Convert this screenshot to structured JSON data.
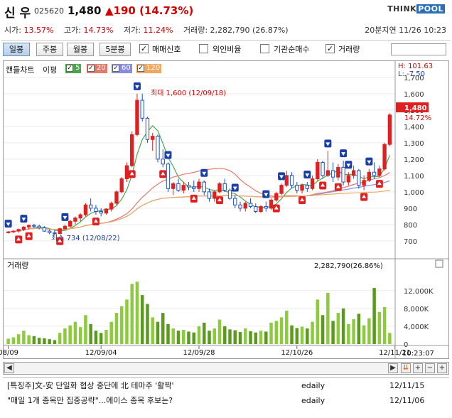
{
  "header": {
    "name": "신 우",
    "code": "025620",
    "price": "1,480",
    "change": "▲190 (14.73%)",
    "logo_think": "THINK",
    "logo_pool": "POOL"
  },
  "stats": {
    "open_label": "시가:",
    "open_value": "13.57%",
    "high_label": "고가:",
    "high_value": "14.73%",
    "low_label": "저가:",
    "low_value": "11.24%",
    "volume": "거래량: 2,282,790 (26.87%)",
    "time": "20분지연  11/26 10:23"
  },
  "toolbar": {
    "period_buttons": [
      "일봉",
      "주봉",
      "월봉",
      "5분봉"
    ],
    "options": [
      {
        "label": "매매신호",
        "checked": true
      },
      {
        "label": "외인비율",
        "checked": false
      },
      {
        "label": "기관순매수",
        "checked": false
      },
      {
        "label": "거래량",
        "checked": true
      }
    ]
  },
  "price_panel": {
    "label": "캔들차트",
    "ma_label": "이평",
    "ma": [
      {
        "period": "5",
        "color": "#4aa64a"
      },
      {
        "period": "20",
        "color": "#e07a6a"
      },
      {
        "period": "60",
        "color": "#8a8ae0"
      },
      {
        "period": "120",
        "color": "#f0a860"
      }
    ],
    "high_label": "H: 101.63",
    "low_label": "L: -7.50",
    "current_price_tag": "1,480",
    "current_change_tag": "14.72%",
    "max_annotation": "최대 1,600 (12/09/18)",
    "min_annotation": "최소 734 (12/08/22)"
  },
  "volume_panel": {
    "label": "거래량",
    "value_label": "2,282,790(26.86%)"
  },
  "bottom_time": "10:23:07",
  "news": [
    {
      "title": "[특징주]文-安 단일화 협상 중단에 北 테마주 '활짝'",
      "source": "edaily",
      "date": "12/11/15"
    },
    {
      "title": "\"매일 1개 종목만 집중공략\"...에이스 종목 후보는?",
      "source": "edaily",
      "date": "12/11/06"
    }
  ],
  "chart_data": {
    "type": "candlestick",
    "price_axis": {
      "ticks": [
        700,
        800,
        900,
        1000,
        1100,
        1200,
        1300,
        1400,
        1500,
        1600,
        1700
      ],
      "ylim": [
        630,
        1760
      ]
    },
    "volume_axis": {
      "ticks": [
        "0",
        "4,000K",
        "8,000K",
        "12,000K"
      ],
      "ylim_k": [
        0,
        15000
      ]
    },
    "x_ticks": [
      "08/09",
      "12/09/04",
      "12/09/28",
      "12/10/26",
      "12/11/21"
    ],
    "x_tick_index": [
      0,
      18,
      37,
      56,
      75
    ],
    "candles": [
      [
        750,
        760,
        745,
        755
      ],
      [
        755,
        765,
        748,
        760
      ],
      [
        760,
        775,
        750,
        770
      ],
      [
        770,
        790,
        760,
        785
      ],
      [
        785,
        800,
        770,
        795
      ],
      [
        795,
        805,
        780,
        790
      ],
      [
        790,
        800,
        770,
        780
      ],
      [
        780,
        790,
        755,
        760
      ],
      [
        760,
        770,
        740,
        750
      ],
      [
        750,
        765,
        734,
        745
      ],
      [
        745,
        780,
        740,
        775
      ],
      [
        775,
        800,
        765,
        790
      ],
      [
        790,
        830,
        780,
        820
      ],
      [
        820,
        850,
        800,
        840
      ],
      [
        840,
        870,
        820,
        860
      ],
      [
        860,
        930,
        850,
        920
      ],
      [
        920,
        960,
        880,
        900
      ],
      [
        900,
        920,
        860,
        880
      ],
      [
        880,
        900,
        850,
        870
      ],
      [
        870,
        900,
        860,
        895
      ],
      [
        895,
        940,
        880,
        930
      ],
      [
        930,
        1010,
        920,
        1000
      ],
      [
        1000,
        1090,
        990,
        1080
      ],
      [
        1080,
        1180,
        1060,
        1160
      ],
      [
        1160,
        1370,
        1150,
        1350
      ],
      [
        1350,
        1600,
        1340,
        1560
      ],
      [
        1560,
        1600,
        1430,
        1450
      ],
      [
        1450,
        1460,
        1300,
        1320
      ],
      [
        1320,
        1360,
        1250,
        1340
      ],
      [
        1340,
        1350,
        1180,
        1200
      ],
      [
        1200,
        1260,
        1150,
        1170
      ],
      [
        1170,
        1180,
        1000,
        1020
      ],
      [
        1020,
        1060,
        980,
        1050
      ],
      [
        1050,
        1080,
        1000,
        1010
      ],
      [
        1010,
        1060,
        990,
        1040
      ],
      [
        1040,
        1060,
        1010,
        1030
      ],
      [
        1030,
        1070,
        1000,
        1020
      ],
      [
        1020,
        1080,
        1000,
        1060
      ],
      [
        1060,
        1070,
        980,
        1000
      ],
      [
        1000,
        1020,
        940,
        960
      ],
      [
        960,
        1010,
        940,
        1000
      ],
      [
        1000,
        1060,
        990,
        1050
      ],
      [
        1050,
        1080,
        1000,
        1010
      ],
      [
        1010,
        1020,
        950,
        960
      ],
      [
        960,
        980,
        900,
        920
      ],
      [
        920,
        940,
        880,
        900
      ],
      [
        900,
        940,
        880,
        930
      ],
      [
        930,
        960,
        900,
        910
      ],
      [
        910,
        930,
        870,
        880
      ],
      [
        880,
        920,
        870,
        910
      ],
      [
        910,
        940,
        880,
        900
      ],
      [
        900,
        960,
        890,
        950
      ],
      [
        950,
        1000,
        940,
        990
      ],
      [
        990,
        1050,
        980,
        1040
      ],
      [
        1040,
        1130,
        1030,
        1100
      ],
      [
        1100,
        1120,
        1020,
        1040
      ],
      [
        1040,
        1060,
        990,
        1010
      ],
      [
        1010,
        1050,
        990,
        1040
      ],
      [
        1040,
        1060,
        1000,
        1020
      ],
      [
        1020,
        1100,
        1010,
        1080
      ],
      [
        1080,
        1200,
        1070,
        1180
      ],
      [
        1180,
        1190,
        1080,
        1100
      ],
      [
        1100,
        1250,
        1090,
        1130
      ],
      [
        1130,
        1180,
        1060,
        1090
      ],
      [
        1090,
        1170,
        1070,
        1150
      ],
      [
        1150,
        1190,
        1040,
        1060
      ],
      [
        1060,
        1120,
        1040,
        1100
      ],
      [
        1100,
        1160,
        1080,
        1130
      ],
      [
        1130,
        1140,
        1020,
        1040
      ],
      [
        1040,
        1100,
        1010,
        1070
      ],
      [
        1070,
        1140,
        1060,
        1120
      ],
      [
        1120,
        1180,
        1080,
        1100
      ],
      [
        1100,
        1160,
        1090,
        1140
      ],
      [
        1140,
        1300,
        1130,
        1290
      ],
      [
        1290,
        1480,
        1280,
        1470
      ]
    ],
    "volume_k": [
      1200,
      1500,
      2200,
      3000,
      2000,
      1800,
      1400,
      1300,
      1100,
      900,
      2500,
      3500,
      4200,
      5000,
      3800,
      6500,
      4500,
      3000,
      2500,
      3200,
      5000,
      7000,
      8500,
      10000,
      13500,
      14000,
      11000,
      9000,
      6000,
      5000,
      7000,
      4500,
      3500,
      3000,
      3200,
      2800,
      2600,
      4000,
      4800,
      3000,
      3500,
      5500,
      4000,
      3300,
      3100,
      2700,
      3500,
      2900,
      2600,
      3000,
      2800,
      4800,
      5200,
      6000,
      7500,
      4200,
      3600,
      3900,
      3500,
      5000,
      10000,
      6500,
      11500,
      5200,
      7000,
      8000,
      4500,
      5600,
      6800,
      4200,
      5800,
      12600,
      7200,
      8300,
      2500
    ],
    "buy_signal_index": [
      0,
      3,
      11,
      25,
      31,
      38,
      44,
      50,
      53,
      58,
      62,
      65,
      66,
      70
    ],
    "sell_signal_index": [
      2,
      4,
      10,
      17,
      24,
      30,
      36,
      41,
      52,
      57,
      61,
      64,
      69,
      72
    ]
  }
}
